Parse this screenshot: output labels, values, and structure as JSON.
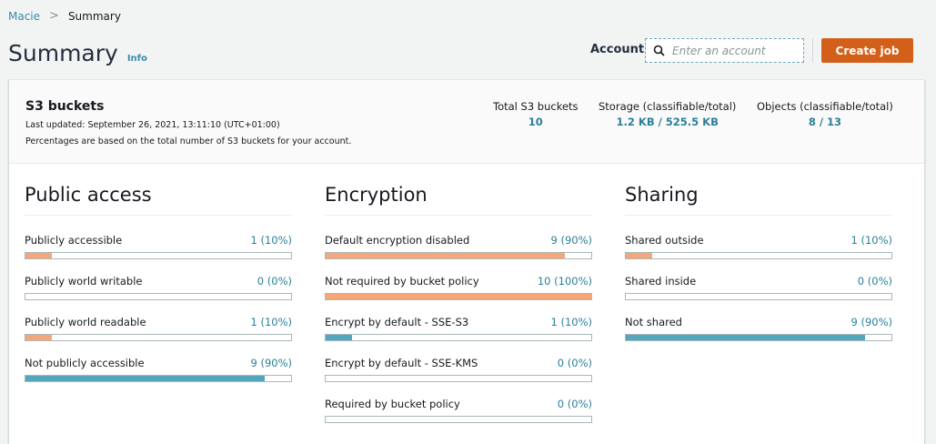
{
  "breadcrumb": {
    "root": "Macie",
    "current": "Summary"
  },
  "header": {
    "title": "Summary",
    "info": "Info",
    "account_label": "Account",
    "account_placeholder": "Enter an account",
    "create_job": "Create job"
  },
  "colors": {
    "accent": "#d2601a",
    "risk": "#f5a77a",
    "ok": "#52a6bd"
  },
  "s3": {
    "title": "S3 buckets",
    "last_updated": "Last updated: September 26, 2021, 13:11:10 (UTC+01:00)",
    "note": "Percentages are based on the total number of S3 buckets for your account.",
    "stats": [
      {
        "label": "Total S3 buckets",
        "value": "10"
      },
      {
        "label": "Storage (classifiable/total)",
        "value": "1.2 KB / 525.5 KB"
      },
      {
        "label": "Objects (classifiable/total)",
        "value": "8 / 13"
      }
    ]
  },
  "sections": [
    {
      "title": "Public access",
      "rows": [
        {
          "label": "Publicly accessible",
          "value": "1 (10%)",
          "percent": 10,
          "kind": "risk"
        },
        {
          "label": "Publicly world writable",
          "value": "0 (0%)",
          "percent": 0,
          "kind": "risk"
        },
        {
          "label": "Publicly world readable",
          "value": "1 (10%)",
          "percent": 10,
          "kind": "risk"
        },
        {
          "label": "Not publicly accessible",
          "value": "9 (90%)",
          "percent": 90,
          "kind": "ok"
        }
      ]
    },
    {
      "title": "Encryption",
      "rows": [
        {
          "label": "Default encryption disabled",
          "value": "9 (90%)",
          "percent": 90,
          "kind": "risk"
        },
        {
          "label": "Not required by bucket policy",
          "value": "10 (100%)",
          "percent": 100,
          "kind": "risk"
        },
        {
          "label": "Encrypt by default - SSE-S3",
          "value": "1 (10%)",
          "percent": 10,
          "kind": "ok"
        },
        {
          "label": "Encrypt by default - SSE-KMS",
          "value": "0 (0%)",
          "percent": 0,
          "kind": "ok"
        },
        {
          "label": "Required by bucket policy",
          "value": "0 (0%)",
          "percent": 0,
          "kind": "ok"
        }
      ]
    },
    {
      "title": "Sharing",
      "rows": [
        {
          "label": "Shared outside",
          "value": "1 (10%)",
          "percent": 10,
          "kind": "risk"
        },
        {
          "label": "Shared inside",
          "value": "0 (0%)",
          "percent": 0,
          "kind": "risk"
        },
        {
          "label": "Not shared",
          "value": "9 (90%)",
          "percent": 90,
          "kind": "ok"
        }
      ]
    }
  ]
}
